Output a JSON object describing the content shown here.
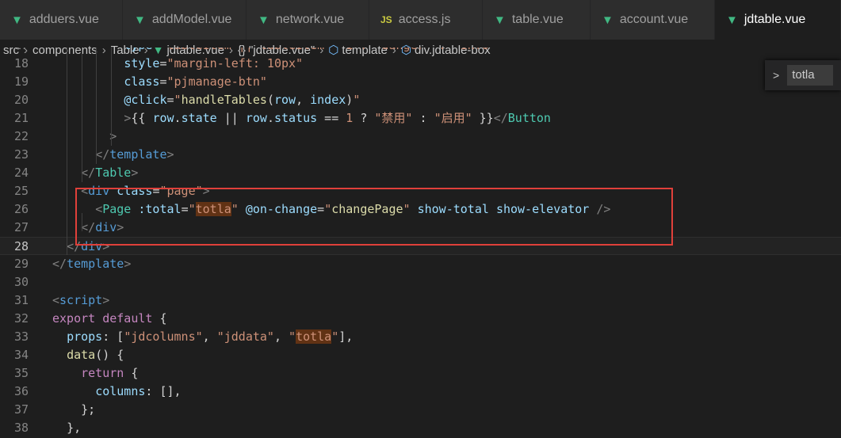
{
  "tabs": [
    {
      "label": "adduers.vue",
      "icon": "vue-icon"
    },
    {
      "label": "addModel.vue",
      "icon": "vue-icon"
    },
    {
      "label": "network.vue",
      "icon": "vue-icon"
    },
    {
      "label": "access.js",
      "icon": "js-icon"
    },
    {
      "label": "table.vue",
      "icon": "vue-icon"
    },
    {
      "label": "account.vue",
      "icon": "vue-icon"
    },
    {
      "label": "jdtable.vue",
      "icon": "vue-icon",
      "active": true
    }
  ],
  "breadcrumb": {
    "src": "src",
    "components": "components",
    "table": "Table",
    "file": "jdtable.vue",
    "braces": "{}",
    "object": "\"jdtable.vue\"",
    "template": "template",
    "div": "div.jdtable-box"
  },
  "find_widget": {
    "chevron": ">",
    "value": "totla"
  },
  "colors": {
    "highlight_box": "#e0403a",
    "vue_green": "#41b883",
    "match_bg": "#613214"
  },
  "code_lines": [
    {
      "n": "17",
      "tokens": [
        [
          "plain",
          "          "
        ],
        [
          "attr",
          "type"
        ],
        [
          "plain",
          "="
        ],
        [
          "str",
          "\"tableItem || tableItem"
        ],
        [
          "plain",
          "   "
        ],
        [
          "str",
          "1 ? \"danger\" : \"info\""
        ]
      ]
    },
    {
      "n": "18",
      "tokens": [
        [
          "plain",
          "          "
        ],
        [
          "attr",
          "style"
        ],
        [
          "plain",
          "="
        ],
        [
          "str",
          "\"margin-left: 10px\""
        ]
      ]
    },
    {
      "n": "19",
      "tokens": [
        [
          "plain",
          "          "
        ],
        [
          "attr",
          "class"
        ],
        [
          "plain",
          "="
        ],
        [
          "str",
          "\"pjmanage-btn\""
        ]
      ]
    },
    {
      "n": "20",
      "tokens": [
        [
          "plain",
          "          "
        ],
        [
          "attr",
          "@click"
        ],
        [
          "plain",
          "="
        ],
        [
          "str",
          "\""
        ],
        [
          "fn",
          "handleTables"
        ],
        [
          "plain",
          "("
        ],
        [
          "var",
          "row"
        ],
        [
          "plain",
          ", "
        ],
        [
          "var",
          "index"
        ],
        [
          "plain",
          ")"
        ],
        [
          "str",
          "\""
        ]
      ]
    },
    {
      "n": "21",
      "tokens": [
        [
          "plain",
          "          "
        ],
        [
          "brk",
          ">"
        ],
        [
          "plain",
          "{{ "
        ],
        [
          "var",
          "row"
        ],
        [
          "plain",
          "."
        ],
        [
          "var",
          "state"
        ],
        [
          "plain",
          " || "
        ],
        [
          "var",
          "row"
        ],
        [
          "plain",
          "."
        ],
        [
          "var",
          "status"
        ],
        [
          "plain",
          " == "
        ],
        [
          "str",
          "1"
        ],
        [
          "plain",
          " ? "
        ],
        [
          "str",
          "\"禁用\""
        ],
        [
          "plain",
          " : "
        ],
        [
          "str",
          "\"启用\""
        ],
        [
          "plain",
          " }}"
        ],
        [
          "brk",
          "</"
        ],
        [
          "comp",
          "Button"
        ]
      ]
    },
    {
      "n": "22",
      "tokens": [
        [
          "plain",
          "        "
        ],
        [
          "brk",
          ">"
        ]
      ]
    },
    {
      "n": "23",
      "tokens": [
        [
          "plain",
          "      "
        ],
        [
          "brk",
          "</"
        ],
        [
          "tag",
          "template"
        ],
        [
          "brk",
          ">"
        ]
      ]
    },
    {
      "n": "24",
      "tokens": [
        [
          "plain",
          "    "
        ],
        [
          "brk",
          "</"
        ],
        [
          "comp",
          "Table"
        ],
        [
          "brk",
          ">"
        ]
      ]
    },
    {
      "n": "25",
      "tokens": [
        [
          "plain",
          "    "
        ],
        [
          "brk",
          "<"
        ],
        [
          "tag",
          "div"
        ],
        [
          "plain",
          " "
        ],
        [
          "attr",
          "class"
        ],
        [
          "plain",
          "="
        ],
        [
          "str",
          "\"page\""
        ],
        [
          "brk",
          ">"
        ]
      ]
    },
    {
      "n": "26",
      "tokens": [
        [
          "plain",
          "      "
        ],
        [
          "brk",
          "<"
        ],
        [
          "comp",
          "Page"
        ],
        [
          "plain",
          " "
        ],
        [
          "attr",
          ":total"
        ],
        [
          "plain",
          "="
        ],
        [
          "str",
          "\""
        ],
        [
          "hl",
          "totla"
        ],
        [
          "str",
          "\""
        ],
        [
          "plain",
          " "
        ],
        [
          "attr",
          "@on-change"
        ],
        [
          "plain",
          "="
        ],
        [
          "str",
          "\""
        ],
        [
          "fn",
          "changePage"
        ],
        [
          "str",
          "\""
        ],
        [
          "plain",
          " "
        ],
        [
          "attr",
          "show-total"
        ],
        [
          "plain",
          " "
        ],
        [
          "attr",
          "show-elevator"
        ],
        [
          "plain",
          " "
        ],
        [
          "brk",
          "/>"
        ]
      ]
    },
    {
      "n": "27",
      "tokens": [
        [
          "plain",
          "    "
        ],
        [
          "brk",
          "</"
        ],
        [
          "tag",
          "div"
        ],
        [
          "brk",
          ">"
        ]
      ]
    },
    {
      "n": "28",
      "current": true,
      "tokens": [
        [
          "plain",
          "  "
        ],
        [
          "brk",
          "</"
        ],
        [
          "tag",
          "div"
        ],
        [
          "brk",
          ">"
        ]
      ]
    },
    {
      "n": "29",
      "tokens": [
        [
          "brk",
          "</"
        ],
        [
          "tag",
          "template"
        ],
        [
          "brk",
          ">"
        ]
      ]
    },
    {
      "n": "30",
      "tokens": []
    },
    {
      "n": "31",
      "tokens": [
        [
          "brk",
          "<"
        ],
        [
          "tag",
          "script"
        ],
        [
          "brk",
          ">"
        ]
      ]
    },
    {
      "n": "32",
      "tokens": [
        [
          "kw",
          "export"
        ],
        [
          "plain",
          " "
        ],
        [
          "kw",
          "default"
        ],
        [
          "plain",
          " {"
        ]
      ]
    },
    {
      "n": "33",
      "tokens": [
        [
          "plain",
          "  "
        ],
        [
          "var",
          "props"
        ],
        [
          "plain",
          ": ["
        ],
        [
          "str",
          "\"jdcolumns\""
        ],
        [
          "plain",
          ", "
        ],
        [
          "str",
          "\"jddata\""
        ],
        [
          "plain",
          ", "
        ],
        [
          "str",
          "\""
        ],
        [
          "hl",
          "totla"
        ],
        [
          "str",
          "\""
        ],
        [
          "plain",
          "],"
        ]
      ]
    },
    {
      "n": "34",
      "tokens": [
        [
          "plain",
          "  "
        ],
        [
          "fn",
          "data"
        ],
        [
          "plain",
          "() {"
        ]
      ]
    },
    {
      "n": "35",
      "tokens": [
        [
          "plain",
          "    "
        ],
        [
          "kw",
          "return"
        ],
        [
          "plain",
          " {"
        ]
      ]
    },
    {
      "n": "36",
      "tokens": [
        [
          "plain",
          "      "
        ],
        [
          "var",
          "columns"
        ],
        [
          "plain",
          ": [],"
        ]
      ]
    },
    {
      "n": "37",
      "tokens": [
        [
          "plain",
          "    "
        ],
        [
          "plain",
          "};"
        ]
      ]
    },
    {
      "n": "38",
      "tokens": [
        [
          "plain",
          "  "
        ],
        [
          "plain",
          "},"
        ]
      ]
    }
  ]
}
